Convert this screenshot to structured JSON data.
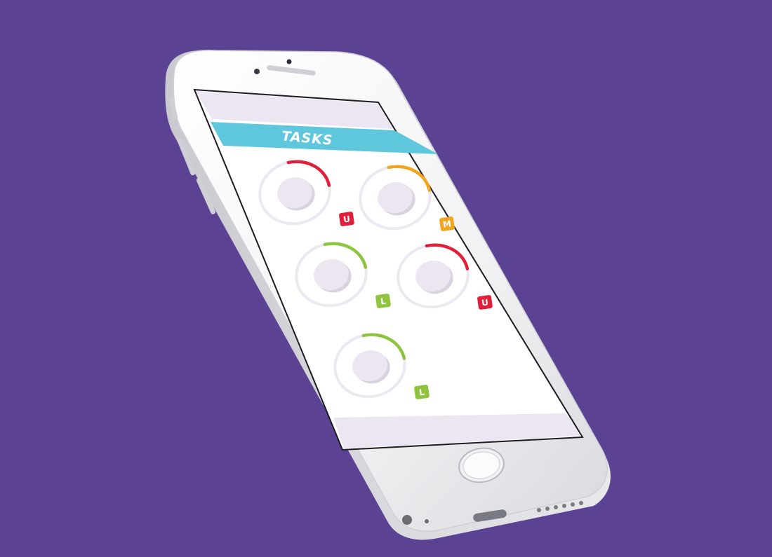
{
  "app": {
    "header_title": "TASKS"
  },
  "colors": {
    "background": "#5b4292",
    "header": "#5fc7dc",
    "urgent": "#e21f3a",
    "medium": "#f2a51e",
    "low": "#8fc43f",
    "ring_track": "#ece8f2",
    "knob": "#ece6f1"
  },
  "tasks": [
    {
      "badge": "U",
      "priority": "urgent",
      "progress": 0.25
    },
    {
      "badge": "M",
      "priority": "medium",
      "progress": 0.25
    },
    {
      "badge": "L",
      "priority": "low",
      "progress": 0.25
    },
    {
      "badge": "U",
      "priority": "urgent",
      "progress": 0.25
    },
    {
      "badge": "L",
      "priority": "low",
      "progress": 0.25
    }
  ]
}
